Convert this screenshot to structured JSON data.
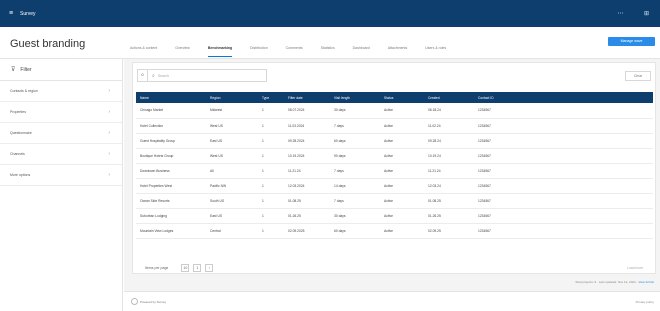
{
  "topbar": {
    "brand": "Survey",
    "bg": "#0e3e6e",
    "user_btn": "⋯",
    "menu_icon": "⊞"
  },
  "page": {
    "title": "Guest branding"
  },
  "tabs": [
    "Actions & content",
    "Overview",
    "Benchmarking",
    "Distribution",
    "Comments",
    "Statistics",
    "Dashboard",
    "Attachments",
    "Users & roles"
  ],
  "primary_button": "Manage wave",
  "sidebar": {
    "title": "Filter",
    "items": [
      "Contacts & region",
      "Properties",
      "Questionnaire",
      "Channels",
      "More options"
    ]
  },
  "search": {
    "placeholder": "Search",
    "count": "0",
    "clear_label": "Clear"
  },
  "table": {
    "headers": [
      "Name",
      "Region",
      "Type",
      "Filter date",
      "Visit length",
      "Status",
      "Created",
      "Contact ID"
    ],
    "rows": [
      [
        "Chicago Market",
        "Midwest",
        "1",
        "08.07.2024",
        "30 days",
        "Active",
        "06.18.24",
        "1234567"
      ],
      [
        "Hotel Collection",
        "West US",
        "1",
        "11.03.2024",
        "7 days",
        "Active",
        "11.02.24",
        "1234567"
      ],
      [
        "Guest Hospitality Group",
        "East US",
        "1",
        "09.28.2024",
        "60 days",
        "Active",
        "09.28.24",
        "1234567"
      ],
      [
        "Boutique Hotels Group",
        "West US",
        "1",
        "10.19.2024",
        "90 days",
        "Active",
        "10.19.24",
        "1234567"
      ],
      [
        "Downtown Business",
        "All",
        "1",
        "11.21.24",
        "7 days",
        "Active",
        "11.21.24",
        "1234567"
      ],
      [
        "Hotel Properties West",
        "Pacific NW",
        "1",
        "12.03.2024",
        "14 days",
        "Active",
        "12.03.24",
        "1234567"
      ],
      [
        "Ocean Side Resorts",
        "South US",
        "1",
        "01.08.25",
        "7 days",
        "Active",
        "01.08.25",
        "1234567"
      ],
      [
        "Suburban Lodging",
        "East US",
        "1",
        "01.26.25",
        "30 days",
        "Active",
        "01.26.25",
        "1234567"
      ],
      [
        "Mountain View Lodges",
        "Central",
        "1",
        "02.09.2025",
        "60 days",
        "Active",
        "02.09.25",
        "1234567"
      ]
    ]
  },
  "pager": {
    "label": "Items per page",
    "per_page": "10",
    "page": "1",
    "next": "Load more"
  },
  "status": {
    "text": "Total projects: 9 · Last updated: Nov 12, 2024 · ",
    "link": "View full list"
  },
  "footer": {
    "brand": "Powered by Survey",
    "right": "Privacy policy"
  }
}
